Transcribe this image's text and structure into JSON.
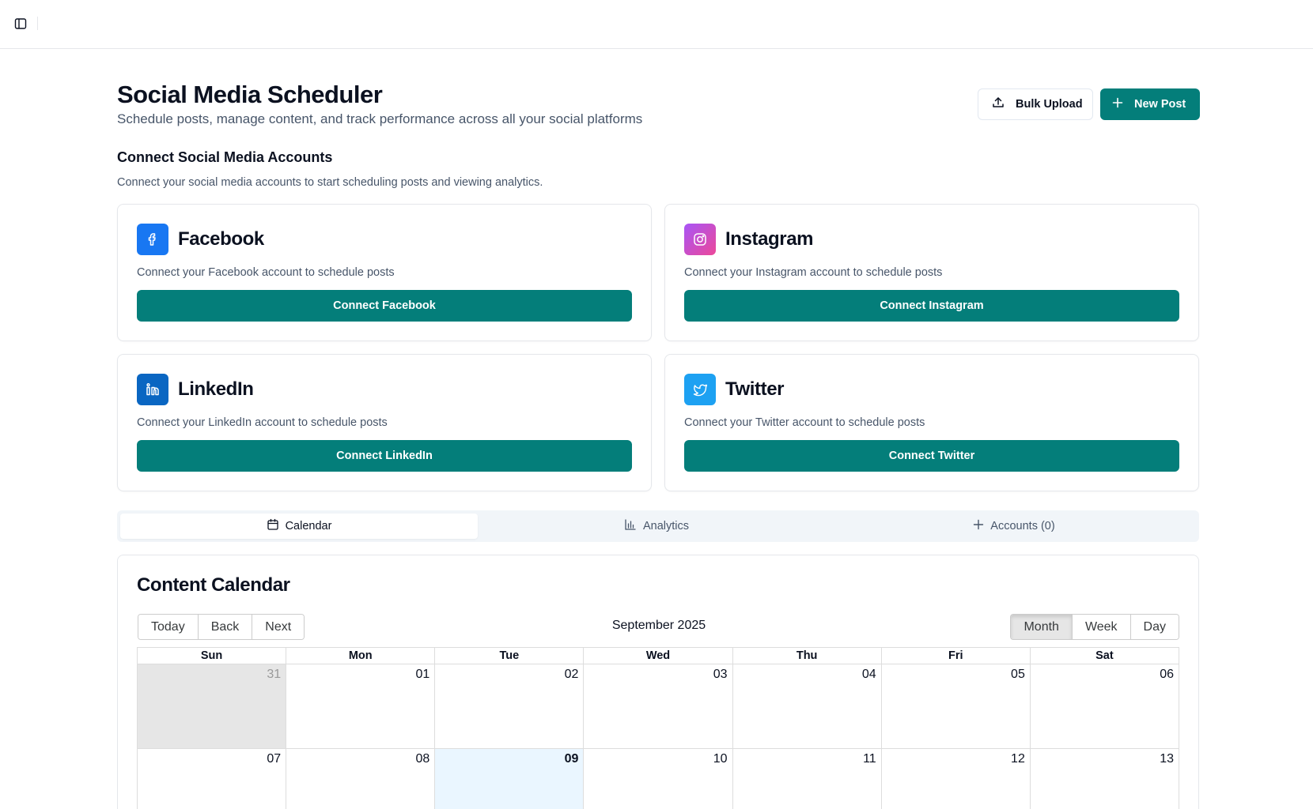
{
  "header": {
    "title": "Social Media Scheduler",
    "subtitle": "Schedule posts, manage content, and track performance across all your social platforms",
    "bulk_upload_label": "Bulk Upload",
    "new_post_label": "New Post"
  },
  "connect": {
    "title": "Connect Social Media Accounts",
    "description": "Connect your social media accounts to start scheduling posts and viewing analytics.",
    "platforms": [
      {
        "name": "Facebook",
        "description": "Connect your Facebook account to schedule posts",
        "button": "Connect Facebook",
        "icon": "facebook-icon",
        "color": "#1877f2"
      },
      {
        "name": "Instagram",
        "description": "Connect your Instagram account to schedule posts",
        "button": "Connect Instagram",
        "icon": "instagram-icon",
        "color": "#d946ef"
      },
      {
        "name": "LinkedIn",
        "description": "Connect your LinkedIn account to schedule posts",
        "button": "Connect LinkedIn",
        "icon": "linkedin-icon",
        "color": "#0a66c2"
      },
      {
        "name": "Twitter",
        "description": "Connect your Twitter account to schedule posts",
        "button": "Connect Twitter",
        "icon": "twitter-icon",
        "color": "#1da1f2"
      }
    ]
  },
  "tabs": [
    {
      "label": "Calendar",
      "icon": "calendar-icon",
      "active": true
    },
    {
      "label": "Analytics",
      "icon": "bar-chart-icon",
      "active": false
    },
    {
      "label": "Accounts (0)",
      "icon": "plus-icon",
      "active": false
    }
  ],
  "calendar": {
    "title": "Content Calendar",
    "nav": {
      "today": "Today",
      "back": "Back",
      "next": "Next"
    },
    "label": "September 2025",
    "views": {
      "month": "Month",
      "week": "Week",
      "day": "Day"
    },
    "active_view": "Month",
    "weekdays": [
      "Sun",
      "Mon",
      "Tue",
      "Wed",
      "Thu",
      "Fri",
      "Sat"
    ],
    "weeks": [
      [
        "31",
        "01",
        "02",
        "03",
        "04",
        "05",
        "06"
      ],
      [
        "07",
        "08",
        "09",
        "10",
        "11",
        "12",
        "13"
      ]
    ]
  },
  "colors": {
    "accent": "#047e7a"
  }
}
